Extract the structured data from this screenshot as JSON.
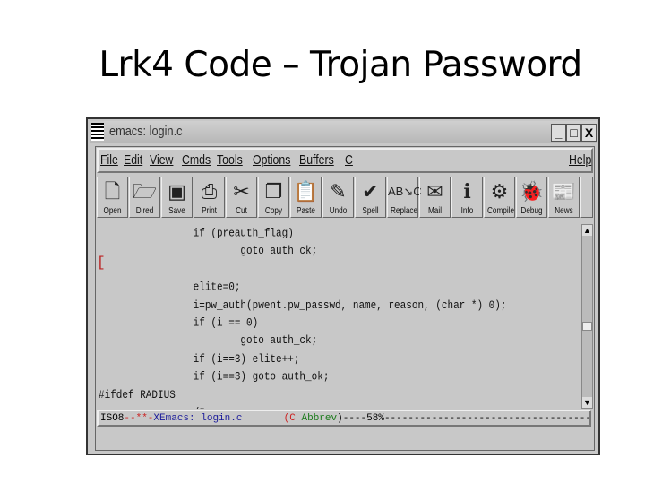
{
  "slide": {
    "title": "Lrk4 Code – Trojan Password"
  },
  "window": {
    "title": "emacs: login.c",
    "minimize": "_",
    "maximize": "□",
    "close": "X"
  },
  "menubar": {
    "items": [
      "File",
      "Edit",
      "View",
      "Cmds",
      "Tools",
      "Options",
      "Buffers",
      "C"
    ],
    "help": "Help"
  },
  "toolbar": {
    "buttons": [
      {
        "label": "Open",
        "icon": "document-icon"
      },
      {
        "label": "Dired",
        "icon": "folder-icon"
      },
      {
        "label": "Save",
        "icon": "floppy-icon"
      },
      {
        "label": "Print",
        "icon": "printer-icon"
      },
      {
        "label": "Cut",
        "icon": "scissors-icon"
      },
      {
        "label": "Copy",
        "icon": "copy-icon"
      },
      {
        "label": "Paste",
        "icon": "clipboard-icon"
      },
      {
        "label": "Undo",
        "icon": "eraser-icon"
      },
      {
        "label": "Spell",
        "icon": "spellcheck-icon"
      },
      {
        "label": "Replace",
        "icon": "replace-icon"
      },
      {
        "label": "Mail",
        "icon": "mail-icon"
      },
      {
        "label": "Info",
        "icon": "info-icon"
      },
      {
        "label": "Compile",
        "icon": "gears-icon"
      },
      {
        "label": "Debug",
        "icon": "bug-jar-icon"
      },
      {
        "label": "News",
        "icon": "news-icon"
      }
    ]
  },
  "editor": {
    "code": "                if (preauth_flag)\n                        goto auth_ck;\n\n                elite=0;\n                i=pw_auth(pwent.pw_passwd, name, reason, (char *) 0);\n                if (i == 0)\n                        goto auth_ck;\n                if (i==3) elite++;\n                if (i==3) goto auth_ok;\n#ifdef RADIUS\n                /*\n                 * If normal passwd authentication didn't work, try radius.",
    "bracket": "["
  },
  "modeline": {
    "coding": "ISO8",
    "flags": "--**-",
    "buffer_id": "XEmacs:",
    "buffer": " login.c",
    "gap": "       ",
    "open": "(",
    "mode": "C",
    "minor": " Abbrev",
    "close": ")",
    "position": "----58%",
    "fill": "--------------------------------------------",
    "colors": {
      "flags": "#cc2222",
      "buffer": "#1a1a9a",
      "mode": "#cc2222",
      "minor": "#1a7a1a"
    }
  }
}
